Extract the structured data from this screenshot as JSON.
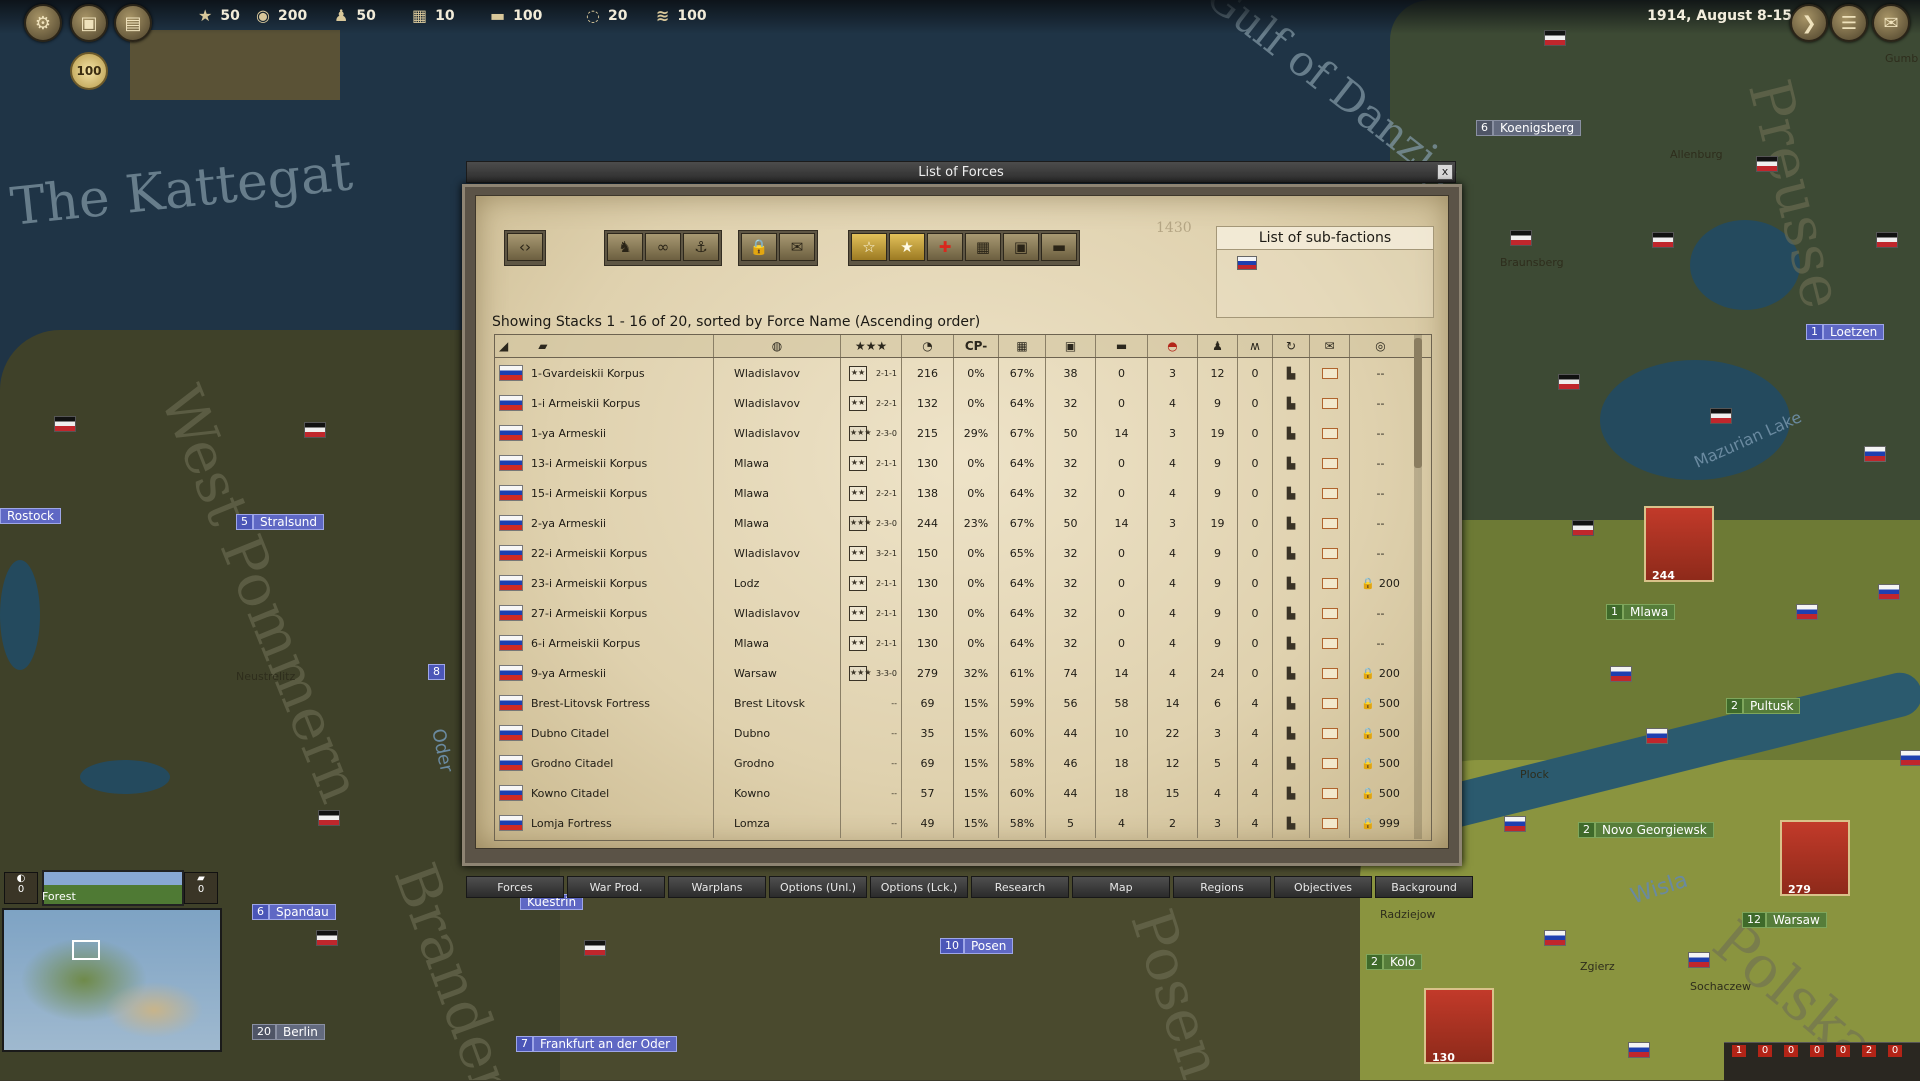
{
  "hud": {
    "resources": [
      {
        "icon": "victory-star-icon",
        "value": "50"
      },
      {
        "icon": "money-icon",
        "value": "200"
      },
      {
        "icon": "manpower-icon",
        "value": "50"
      },
      {
        "icon": "war-supplies-icon",
        "value": "10"
      },
      {
        "icon": "rail-transport-icon",
        "value": "100"
      },
      {
        "icon": "fuel-icon",
        "value": "20"
      },
      {
        "icon": "naval-transport-icon",
        "value": "100"
      }
    ],
    "date": "1914, August 8-15",
    "badge": "100"
  },
  "dialog": {
    "title": "List of Forces",
    "close_label": "x",
    "counter": "1430",
    "showing_text": "Showing Stacks 1 - 16 of  20, sorted by Force Name  (Ascending order)",
    "subfactions_title": "List of sub-factions",
    "columns": [
      {
        "icon": "unit-type-icon"
      },
      {
        "icon": "cannon-icon"
      },
      {
        "icon": "globe-icon"
      },
      {
        "icon": "stars-icon"
      },
      {
        "icon": "gauge-icon"
      },
      {
        "label": "CP-"
      },
      {
        "icon": "grid-icon"
      },
      {
        "icon": "supply-chest-icon"
      },
      {
        "icon": "ammo-icon"
      },
      {
        "icon": "morale-meter-icon"
      },
      {
        "icon": "soldiers-icon"
      },
      {
        "icon": "mountain-icon"
      },
      {
        "icon": "rotate-arrow-icon"
      },
      {
        "icon": "envelope-icon"
      },
      {
        "icon": "coin-icon"
      }
    ],
    "rows": [
      {
        "name": "1-Gvardeiskii Korpus",
        "location": "Wladislavov",
        "stars": "2",
        "rating": "2-1-1",
        "power": "216",
        "cp": "0%",
        "cohesion": "67%",
        "supply": "38",
        "ammo": "0",
        "morale": "3",
        "men": "12",
        "m": "0",
        "pool": "--"
      },
      {
        "name": "1-i Armeiskii Korpus",
        "location": "Wladislavov",
        "stars": "2",
        "rating": "2-2-1",
        "power": "132",
        "cp": "0%",
        "cohesion": "64%",
        "supply": "32",
        "ammo": "0",
        "morale": "4",
        "men": "9",
        "m": "0",
        "pool": "--"
      },
      {
        "name": "1-ya Armeskii",
        "location": "Wladislavov",
        "stars": "3",
        "rating": "2-3-0",
        "power": "215",
        "cp": "29%",
        "cohesion": "67%",
        "supply": "50",
        "ammo": "14",
        "morale": "3",
        "men": "19",
        "m": "0",
        "pool": "--"
      },
      {
        "name": "13-i Armeiskii Korpus",
        "location": "Mlawa",
        "stars": "2",
        "rating": "2-1-1",
        "power": "130",
        "cp": "0%",
        "cohesion": "64%",
        "supply": "32",
        "ammo": "0",
        "morale": "4",
        "men": "9",
        "m": "0",
        "pool": "--"
      },
      {
        "name": "15-i Armeiskii Korpus",
        "location": "Mlawa",
        "stars": "2",
        "rating": "2-2-1",
        "power": "138",
        "cp": "0%",
        "cohesion": "64%",
        "supply": "32",
        "ammo": "0",
        "morale": "4",
        "men": "9",
        "m": "0",
        "pool": "--"
      },
      {
        "name": "2-ya Armeskii",
        "location": "Mlawa",
        "stars": "3",
        "rating": "2-3-0",
        "power": "244",
        "cp": "23%",
        "cohesion": "67%",
        "supply": "50",
        "ammo": "14",
        "morale": "3",
        "men": "19",
        "m": "0",
        "pool": "--"
      },
      {
        "name": "22-i Armeiskii Korpus",
        "location": "Wladislavov",
        "stars": "2",
        "rating": "3-2-1",
        "power": "150",
        "cp": "0%",
        "cohesion": "65%",
        "supply": "32",
        "ammo": "0",
        "morale": "4",
        "men": "9",
        "m": "0",
        "pool": "--"
      },
      {
        "name": "23-i Armeiskii Korpus",
        "location": "Lodz",
        "stars": "2",
        "rating": "2-1-1",
        "power": "130",
        "cp": "0%",
        "cohesion": "64%",
        "supply": "32",
        "ammo": "0",
        "morale": "4",
        "men": "9",
        "m": "0",
        "pool": "200",
        "locked": true
      },
      {
        "name": "27-i Armeiskii Korpus",
        "location": "Wladislavov",
        "stars": "2",
        "rating": "2-1-1",
        "power": "130",
        "cp": "0%",
        "cohesion": "64%",
        "supply": "32",
        "ammo": "0",
        "morale": "4",
        "men": "9",
        "m": "0",
        "pool": "--"
      },
      {
        "name": "6-i Armeiskii Korpus",
        "location": "Mlawa",
        "stars": "2",
        "rating": "2-1-1",
        "power": "130",
        "cp": "0%",
        "cohesion": "64%",
        "supply": "32",
        "ammo": "0",
        "morale": "4",
        "men": "9",
        "m": "0",
        "pool": "--"
      },
      {
        "name": "9-ya Armeskii",
        "location": "Warsaw",
        "stars": "3",
        "rating": "3-3-0",
        "power": "279",
        "cp": "32%",
        "cohesion": "61%",
        "supply": "74",
        "ammo": "14",
        "morale": "4",
        "men": "24",
        "m": "0",
        "pool": "200",
        "locked": true
      },
      {
        "name": "Brest-Litovsk Fortress",
        "location": "Brest Litovsk",
        "stars": "",
        "rating": "--",
        "power": "69",
        "cp": "15%",
        "cohesion": "59%",
        "supply": "56",
        "ammo": "58",
        "morale": "14",
        "men": "6",
        "m": "4",
        "pool": "500",
        "locked": true
      },
      {
        "name": "Dubno Citadel",
        "location": "Dubno",
        "stars": "",
        "rating": "--",
        "power": "35",
        "cp": "15%",
        "cohesion": "60%",
        "supply": "44",
        "ammo": "10",
        "morale": "22",
        "men": "3",
        "m": "4",
        "pool": "500",
        "locked": true
      },
      {
        "name": "Grodno Citadel",
        "location": "Grodno",
        "stars": "",
        "rating": "--",
        "power": "69",
        "cp": "15%",
        "cohesion": "58%",
        "supply": "46",
        "ammo": "18",
        "morale": "12",
        "men": "5",
        "m": "4",
        "pool": "500",
        "locked": true
      },
      {
        "name": "Kowno Citadel",
        "location": "Kowno",
        "stars": "",
        "rating": "--",
        "power": "57",
        "cp": "15%",
        "cohesion": "60%",
        "supply": "44",
        "ammo": "18",
        "morale": "15",
        "men": "4",
        "m": "4",
        "pool": "500",
        "locked": true
      },
      {
        "name": "Lomja Fortress",
        "location": "Lomza",
        "stars": "",
        "rating": "--",
        "power": "49",
        "cp": "15%",
        "cohesion": "58%",
        "supply": "5",
        "ammo": "4",
        "morale": "2",
        "men": "3",
        "m": "4",
        "pool": "999",
        "locked": true
      }
    ]
  },
  "tabs": [
    "Forces",
    "War Prod.",
    "Warplans",
    "Options (Unl.)",
    "Options (Lck.)",
    "Research",
    "Map",
    "Regions",
    "Objectives",
    "Background"
  ],
  "minimap": {
    "terrain": "Forest",
    "left_count": "0",
    "right_count": "0"
  },
  "map": {
    "sea_labels": [
      "The Kattegat",
      "Gulf of Danzig"
    ],
    "region_labels": [
      "West Pommern",
      "Branden",
      "Preusse",
      "Posen",
      "Polska"
    ],
    "cities": [
      {
        "num": "6",
        "name": "Koenigsberg",
        "side": "de"
      },
      {
        "num": "1",
        "name": "Loetzen",
        "side": "de"
      },
      {
        "num": "",
        "name": "Rostock",
        "side": "de"
      },
      {
        "num": "5",
        "name": "Stralsund",
        "side": "de"
      },
      {
        "num": "8",
        "name": "",
        "side": "de"
      },
      {
        "num": "1",
        "name": "Mlawa",
        "side": "ru"
      },
      {
        "num": "2",
        "name": "Pultusk",
        "side": "ru"
      },
      {
        "num": "2",
        "name": "Novo Georgiewsk",
        "side": "ru"
      },
      {
        "num": "12",
        "name": "Warsaw",
        "side": "ru"
      },
      {
        "num": "2",
        "name": "Kolo",
        "side": "ru"
      },
      {
        "num": "10",
        "name": "Posen",
        "side": "de"
      },
      {
        "num": "6",
        "name": "Spandau",
        "side": "de"
      },
      {
        "num": "20",
        "name": "Berlin",
        "side": "de"
      },
      {
        "num": "7",
        "name": "Frankfurt an der Oder",
        "side": "de"
      },
      {
        "num": "",
        "name": "Kuestrin",
        "side": "de"
      }
    ],
    "towns": [
      "Allenburg",
      "Braunsberg",
      "Neustrelitz",
      "Plock",
      "Radziejow",
      "Sochaczew",
      "Zgierz",
      "Gumb",
      "Mazurian Lake",
      "Wisla",
      "Oder"
    ],
    "units": [
      "244",
      "279",
      "130",
      "2",
      "2"
    ]
  },
  "br_counters": [
    "1",
    "0",
    "0",
    "0",
    "0",
    "2",
    "0"
  ]
}
